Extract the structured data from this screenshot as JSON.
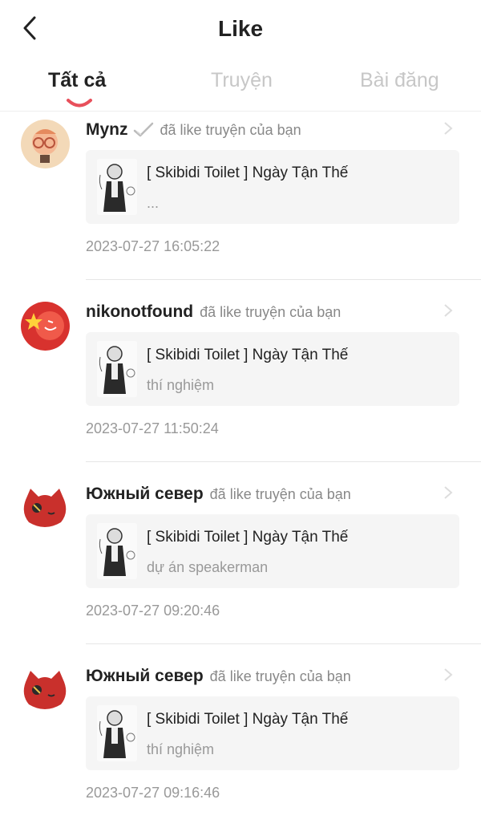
{
  "header": {
    "title": "Like"
  },
  "tabs": [
    {
      "label": "Tất cả",
      "active": true
    },
    {
      "label": "Truyện",
      "active": false
    },
    {
      "label": "Bài đăng",
      "active": false
    }
  ],
  "colors": {
    "accent": "#e8505b",
    "text": "#222222",
    "muted": "#999999",
    "card_bg": "#f5f5f5"
  },
  "notifications": [
    {
      "username": "Mynz",
      "verified": true,
      "action": "đã like truyện của bạn",
      "story_title": "[ Skibidi Toilet ] Ngày Tận Thế",
      "story_sub": "...",
      "timestamp": "2023-07-27 16:05:22",
      "avatar_icon": "user-avatar-icon"
    },
    {
      "username": "nikonotfound",
      "verified": false,
      "action": "đã like truyện của bạn",
      "story_title": "[ Skibidi Toilet ] Ngày Tận Thế",
      "story_sub": "thí nghiệm",
      "timestamp": "2023-07-27 11:50:24",
      "avatar_icon": "user-avatar-icon"
    },
    {
      "username": "Южный север",
      "verified": false,
      "action": "đã like truyện của bạn",
      "story_title": "[ Skibidi Toilet ] Ngày Tận Thế",
      "story_sub": "dự án speakerman",
      "timestamp": "2023-07-27 09:20:46",
      "avatar_icon": "user-avatar-icon"
    },
    {
      "username": "Южный север",
      "verified": false,
      "action": "đã like truyện của bạn",
      "story_title": "[ Skibidi Toilet ] Ngày Tận Thế",
      "story_sub": "thí nghiệm",
      "timestamp": "2023-07-27 09:16:46",
      "avatar_icon": "user-avatar-icon"
    }
  ]
}
